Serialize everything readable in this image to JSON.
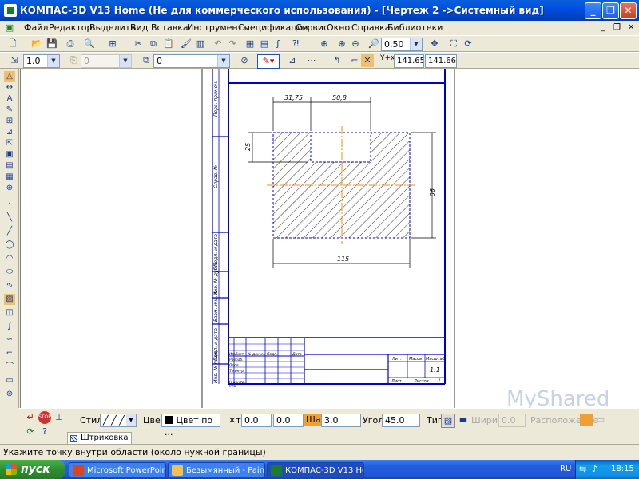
{
  "window": {
    "title": "КОМПАС-3D V13 Home (Не для коммерческого использования) - [Чертеж 2 ->Системный вид]",
    "controls": {
      "minimize": "_",
      "maximize": "❐",
      "close": "✕"
    }
  },
  "menu": {
    "items": [
      "Файл",
      "Редактор",
      "Выделить",
      "Вид",
      "Вставка",
      "Инструменты",
      "Спецификация",
      "Сервис",
      "Окно",
      "Справка",
      "Библиотеки"
    ]
  },
  "toolbar1": {
    "zoom_value": "0.50"
  },
  "toolbar2": {
    "line_scale": "1.0",
    "layer_number": "0",
    "layer_combo": "0",
    "coord_x": "141.656",
    "coord_y": "141.667",
    "coord_label": "Y+x"
  },
  "drawing": {
    "dimensions": {
      "top_left": "31,75",
      "top_right": "50,8",
      "left_height": "25",
      "right_height": "90",
      "bottom_width": "115"
    },
    "title_block": {
      "col_headers": [
        "Изм",
        "Лист",
        "№ докум.",
        "Подп.",
        "Дата"
      ],
      "row_labels": [
        "Разраб.",
        "Пров.",
        "Т.контр.",
        "Н.контр.",
        "Утв."
      ],
      "lit": "Лит.",
      "mass": "Масса",
      "scale_label": "Масштаб",
      "scale_value": "1:1",
      "sheet": "Лист",
      "sheets": "Листов",
      "sheets_value": "1"
    },
    "side_labels": [
      "Перв. примен.",
      "Справ. №",
      "Подп. и дата",
      "Инв. № дубл.",
      "Взам. инв. №",
      "Подп. и дата",
      "Инв. № подл."
    ],
    "colors": {
      "frame": "#0000cc",
      "hatch": "#000000",
      "axis": "#ff8c00"
    }
  },
  "properties": {
    "style_label": "Стиль",
    "color_label": "Цвет",
    "color_value": "Цвет по ...",
    "coord_t_label": "т",
    "coord_t_x": "0.0",
    "coord_t_y": "0.0",
    "step_label": "Шаг",
    "step_value": "3.0",
    "angle_label": "Угол",
    "angle_value": "45.0",
    "type_label": "Тип",
    "width_label": "Ширина",
    "width_value": "0.0",
    "placement_label": "Расположение",
    "tab_label": "Штриховка"
  },
  "status": {
    "text": "Укажите точку внутри области (около нужной границы)"
  },
  "watermark": "MyShared",
  "taskbar": {
    "start": "пуск",
    "tasks": [
      {
        "label": "Microsoft PowerPoint ...",
        "active": false,
        "icon_color": "#d24726"
      },
      {
        "label": "Безымянный - Paint",
        "active": false,
        "icon_color": "#f2c14e"
      },
      {
        "label": "КОМПАС-3D V13 Ho...",
        "active": true,
        "icon_color": "#1f7a2c"
      }
    ],
    "lang": "RU",
    "time": "18:15"
  }
}
